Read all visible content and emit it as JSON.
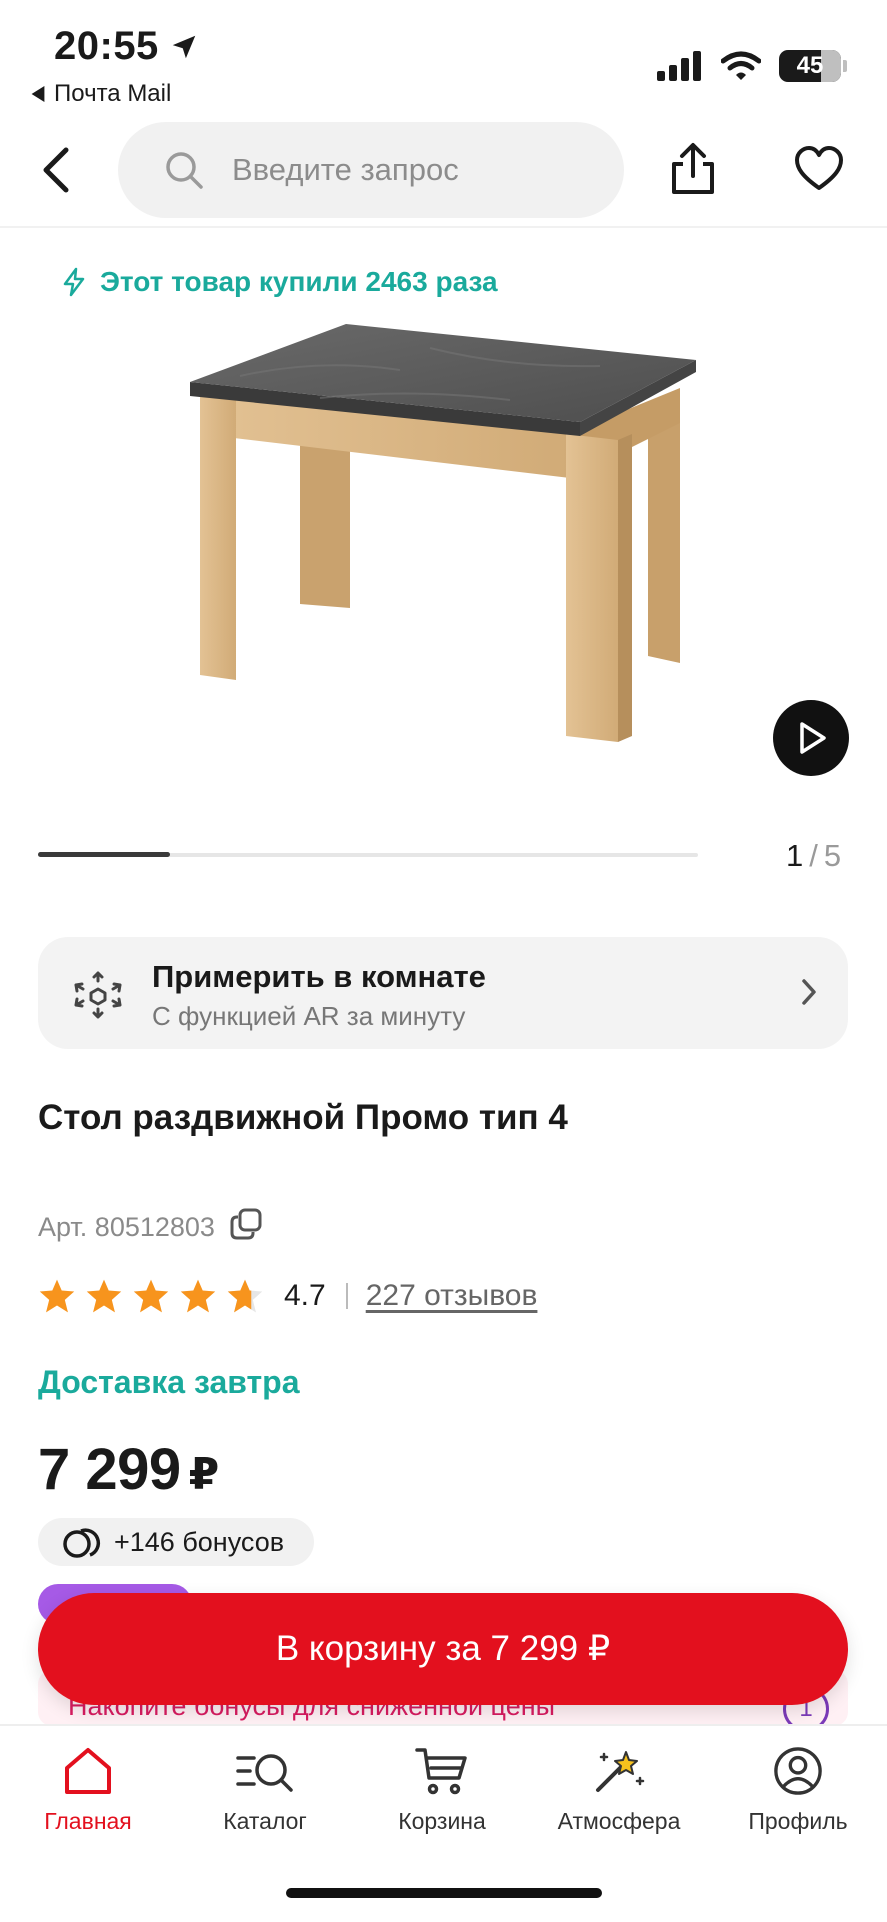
{
  "status_bar": {
    "time": "20:55",
    "back_app": "Почта Mail",
    "battery": "45"
  },
  "header": {
    "search_placeholder": "Введите запрос"
  },
  "purchase_note": "Этот товар купили 2463 раза",
  "gallery": {
    "current": "1",
    "separator": "/",
    "total": "5",
    "progress": 0.2
  },
  "ar_banner": {
    "title": "Примерить в комнате",
    "subtitle": "С функцией AR за минуту"
  },
  "product": {
    "title": "Стол раздвижной Промо тип 4",
    "article": "Арт. 80512803",
    "rating": "4.7",
    "rating_stars": 4.7,
    "reviews": "227 отзывов",
    "delivery": "Доставка завтра",
    "price": "7 299",
    "currency": "₽",
    "bonus": "+146 бонусов"
  },
  "promo_strip": {
    "text": "Накопите бонусы для сниженной цены",
    "badge": "1"
  },
  "cart_button": {
    "label": "В корзину за 7 299 ₽"
  },
  "tabbar": {
    "items": [
      {
        "label": "Главная",
        "icon": "home-icon",
        "active": true
      },
      {
        "label": "Каталог",
        "icon": "catalog-icon",
        "active": false
      },
      {
        "label": "Корзина",
        "icon": "cart-icon",
        "active": false
      },
      {
        "label": "Атмосфера",
        "icon": "sparkle-icon",
        "active": false
      },
      {
        "label": "Профиль",
        "icon": "profile-icon",
        "active": false
      }
    ]
  },
  "colors": {
    "accent_red": "#e3101e",
    "teal": "#1aaa9c",
    "star": "#f7941d"
  }
}
